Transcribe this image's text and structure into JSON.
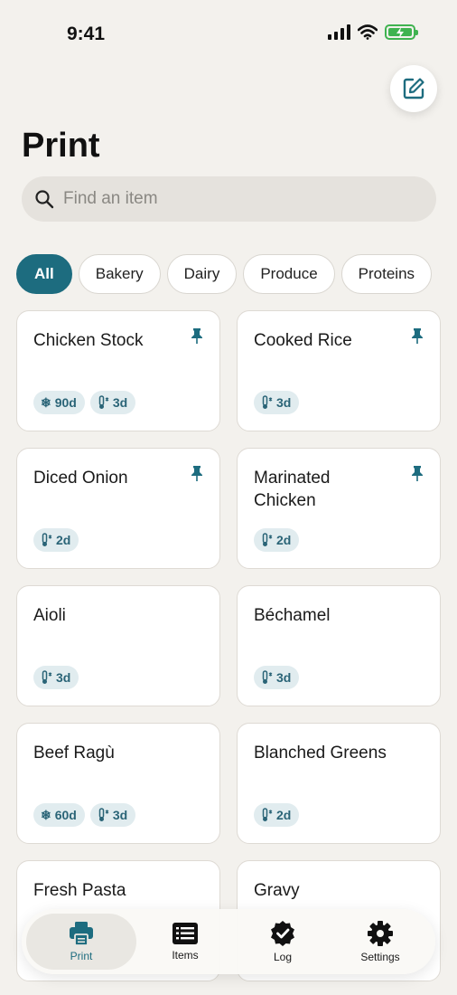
{
  "status_bar": {
    "time": "9:41"
  },
  "header": {
    "title": "Print",
    "compose_icon": "compose-icon"
  },
  "search": {
    "placeholder": "Find an item",
    "value": ""
  },
  "filters": [
    {
      "label": "All",
      "active": true
    },
    {
      "label": "Bakery",
      "active": false
    },
    {
      "label": "Dairy",
      "active": false
    },
    {
      "label": "Produce",
      "active": false
    },
    {
      "label": "Proteins",
      "active": false
    }
  ],
  "items": [
    {
      "name": "Chicken Stock",
      "pinned": true,
      "badges": [
        {
          "icon": "snowflake-icon",
          "text": "90d"
        },
        {
          "icon": "thermometer-icon",
          "text": "3d"
        }
      ]
    },
    {
      "name": "Cooked Rice",
      "pinned": true,
      "badges": [
        {
          "icon": "thermometer-icon",
          "text": "3d"
        }
      ]
    },
    {
      "name": "Diced Onion",
      "pinned": true,
      "badges": [
        {
          "icon": "thermometer-icon",
          "text": "2d"
        }
      ]
    },
    {
      "name": "Marinated Chicken",
      "pinned": true,
      "badges": [
        {
          "icon": "thermometer-icon",
          "text": "2d"
        }
      ]
    },
    {
      "name": "Aioli",
      "pinned": false,
      "badges": [
        {
          "icon": "thermometer-icon",
          "text": "3d"
        }
      ]
    },
    {
      "name": "Béchamel",
      "pinned": false,
      "badges": [
        {
          "icon": "thermometer-icon",
          "text": "3d"
        }
      ]
    },
    {
      "name": "Beef Ragù",
      "pinned": false,
      "badges": [
        {
          "icon": "snowflake-icon",
          "text": "60d"
        },
        {
          "icon": "thermometer-icon",
          "text": "3d"
        }
      ]
    },
    {
      "name": "Blanched Greens",
      "pinned": false,
      "badges": [
        {
          "icon": "thermometer-icon",
          "text": "2d"
        }
      ]
    },
    {
      "name": "Fresh Pasta",
      "pinned": false,
      "badges": []
    },
    {
      "name": "Gravy",
      "pinned": false,
      "badges": []
    }
  ],
  "tabs": [
    {
      "label": "Print",
      "icon": "printer-icon",
      "active": true
    },
    {
      "label": "Items",
      "icon": "list-icon",
      "active": false
    },
    {
      "label": "Log",
      "icon": "check-badge-icon",
      "active": false
    },
    {
      "label": "Settings",
      "icon": "gear-icon",
      "active": false
    }
  ],
  "colors": {
    "accent": "#1d6c7f",
    "background": "#f3f1ed",
    "badge_bg": "#e1ecef"
  }
}
